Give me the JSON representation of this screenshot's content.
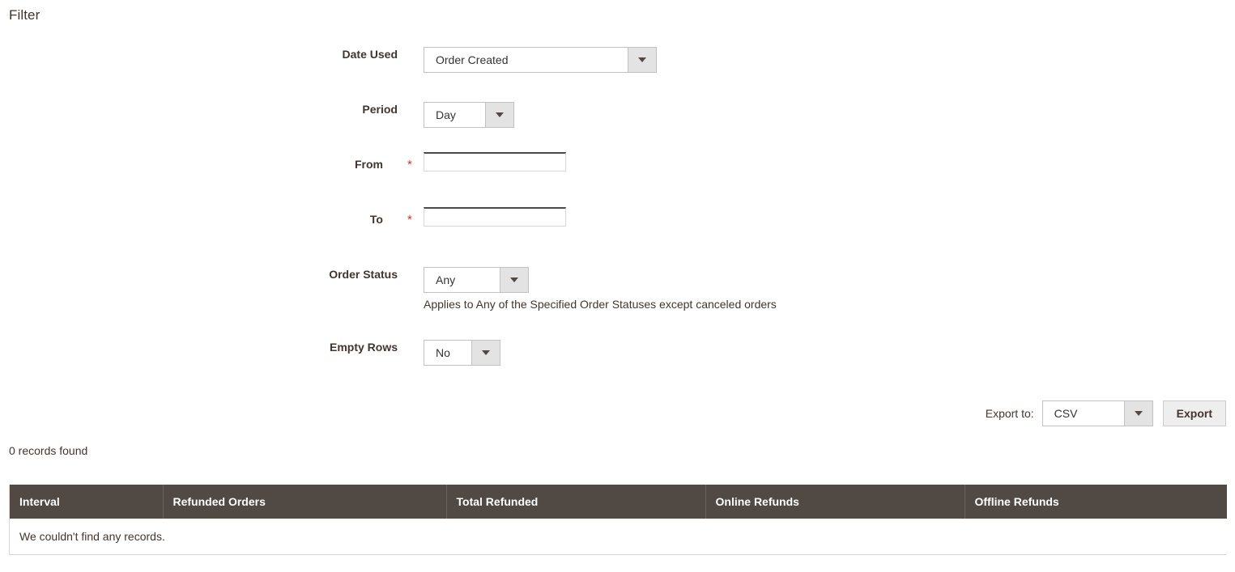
{
  "page": {
    "heading": "Filter"
  },
  "form": {
    "fields": [
      {
        "id": "date-used",
        "label": "Date Used",
        "type": "select",
        "value": "Order Created",
        "required": false
      },
      {
        "id": "period",
        "label": "Period",
        "type": "select",
        "value": "Day",
        "required": false
      },
      {
        "id": "from",
        "label": "From",
        "type": "text",
        "value": "",
        "placeholder": "",
        "required": true,
        "required_marker": "*"
      },
      {
        "id": "to",
        "label": "To",
        "type": "text",
        "value": "",
        "placeholder": "",
        "required": true,
        "required_marker": "*"
      },
      {
        "id": "order-status",
        "label": "Order Status",
        "type": "select",
        "value": "Any",
        "required": false,
        "note": "Applies to Any of the Specified Order Statuses except canceled orders"
      },
      {
        "id": "empty-rows",
        "label": "Empty Rows",
        "type": "select",
        "value": "No",
        "required": false
      }
    ]
  },
  "export": {
    "label": "Export to:",
    "format_value": "CSV",
    "button_label": "Export"
  },
  "grid": {
    "records_found": "0 records found",
    "columns": [
      "Interval",
      "Refunded Orders",
      "Total Refunded",
      "Online Refunds",
      "Offline Refunds"
    ],
    "empty_message": "We couldn't find any records.",
    "rows": []
  },
  "colors": {
    "header_background": "#514943",
    "header_text": "#ffffff",
    "required_star": "#e02b27",
    "select_arrow_background": "#e3e3e3",
    "border": "#c2c2c2",
    "text": "#41362f",
    "button_background": "#eeeeee"
  }
}
